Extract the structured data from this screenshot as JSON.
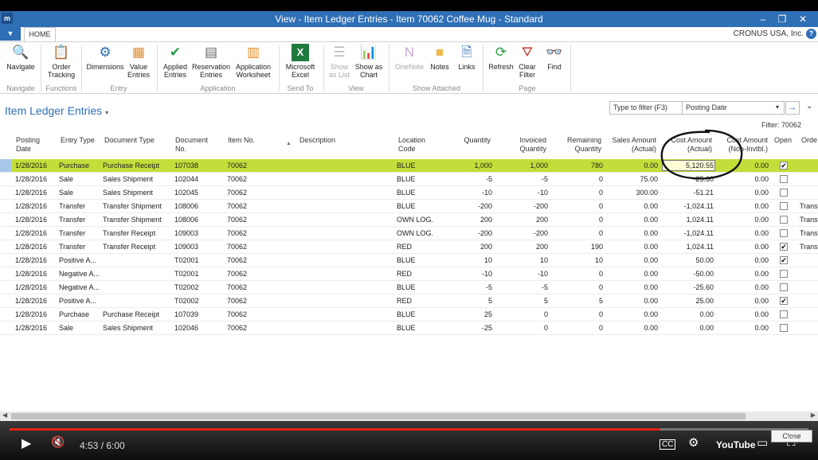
{
  "window": {
    "title": "View - Item Ledger Entries - Item 70062 Coffee Mug - Standard",
    "logo": "m",
    "min_icon": "minimize-icon",
    "restore_icon": "restore-icon",
    "close_icon": "close-icon"
  },
  "tabs": {
    "file_glyph": "▼",
    "home": "HOME",
    "company": "CRONUS USA, Inc.",
    "help": "?"
  },
  "ribbon": {
    "navigate": "Navigate",
    "order_tracking_1": "Order",
    "order_tracking_2": "Tracking",
    "dimensions": "Dimensions",
    "value_entries_1": "Value",
    "value_entries_2": "Entries",
    "applied_entries_1": "Applied",
    "applied_entries_2": "Entries",
    "reservation_entries_1": "Reservation",
    "reservation_entries_2": "Entries",
    "application_worksheet_1": "Application",
    "application_worksheet_2": "Worksheet",
    "microsoft_excel_1": "Microsoft",
    "microsoft_excel_2": "Excel",
    "show_as_list_1": "Show",
    "show_as_list_2": "as List",
    "show_as_chart_1": "Show as",
    "show_as_chart_2": "Chart",
    "onenote": "OneNote",
    "notes": "Notes",
    "links": "Links",
    "refresh": "Refresh",
    "clear_filter_1": "Clear",
    "clear_filter_2": "Filter",
    "find": "Find",
    "groups": {
      "navigate": "Navigate",
      "functions": "Functions",
      "entry": "Entry",
      "application": "Application",
      "send_to": "Send To",
      "view": "View",
      "show_attached": "Show Attached",
      "page": "Page"
    }
  },
  "page": {
    "title": "Item Ledger Entries",
    "caret": "▾",
    "filter_placeholder": "Type to filter (F3)",
    "filter_field": "Posting Date",
    "filter_dd": "▾",
    "filter_go": "→",
    "collapse": "⌄",
    "filter_line": "Filter: 70062"
  },
  "columns": {
    "posting_date_1": "Posting",
    "posting_date_2": "Date",
    "entry_type": "Entry Type",
    "document_type": "Document Type",
    "document_no_1": "Document",
    "document_no_2": "No.",
    "item_no": "Item No.",
    "sort_icon": "▲",
    "description": "Description",
    "location_code_1": "Location",
    "location_code_2": "Code",
    "quantity": "Quantity",
    "invoiced_quantity_1": "Invoiced",
    "invoiced_quantity_2": "Quantity",
    "remaining_quantity_1": "Remaining",
    "remaining_quantity_2": "Quantity",
    "sales_amount_1": "Sales Amount",
    "sales_amount_2": "(Actual)",
    "cost_amount_1": "Cost Amount",
    "cost_amount_2": "(Actual)",
    "cost_non_invtbl_1": "Cost Amount",
    "cost_non_invtbl_2": "(Non-Invtbl.)",
    "open": "Open",
    "order_type": "Orde"
  },
  "rows": [
    {
      "date": "1/28/2016",
      "entry_type": "Purchase",
      "doc_type": "Purchase Receipt",
      "doc_no": "107038",
      "item": "70062",
      "loc": "BLUE",
      "qty": "1,000",
      "inv": "1,000",
      "rem": "780",
      "sales": "0.00",
      "cost": "5,120.55",
      "nonint": "0.00",
      "open": true,
      "order": "",
      "selected": true
    },
    {
      "date": "1/28/2016",
      "entry_type": "Sale",
      "doc_type": "Sales Shipment",
      "doc_no": "102044",
      "item": "70062",
      "loc": "BLUE",
      "qty": "-5",
      "inv": "-5",
      "rem": "0",
      "sales": "75.00",
      "cost": "-25.60",
      "nonint": "0.00",
      "open": false,
      "order": ""
    },
    {
      "date": "1/28/2016",
      "entry_type": "Sale",
      "doc_type": "Sales Shipment",
      "doc_no": "102045",
      "item": "70062",
      "loc": "BLUE",
      "qty": "-10",
      "inv": "-10",
      "rem": "0",
      "sales": "300.00",
      "cost": "-51.21",
      "nonint": "0.00",
      "open": false,
      "order": ""
    },
    {
      "date": "1/28/2016",
      "entry_type": "Transfer",
      "doc_type": "Transfer Shipment",
      "doc_no": "108006",
      "item": "70062",
      "loc": "BLUE",
      "qty": "-200",
      "inv": "-200",
      "rem": "0",
      "sales": "0.00",
      "cost": "-1,024.11",
      "nonint": "0.00",
      "open": false,
      "order": "Transf"
    },
    {
      "date": "1/28/2016",
      "entry_type": "Transfer",
      "doc_type": "Transfer Shipment",
      "doc_no": "108006",
      "item": "70062",
      "loc": "OWN LOG.",
      "qty": "200",
      "inv": "200",
      "rem": "0",
      "sales": "0.00",
      "cost": "1,024.11",
      "nonint": "0.00",
      "open": false,
      "order": "Transf"
    },
    {
      "date": "1/28/2016",
      "entry_type": "Transfer",
      "doc_type": "Transfer Receipt",
      "doc_no": "109003",
      "item": "70062",
      "loc": "OWN LOG.",
      "qty": "-200",
      "inv": "-200",
      "rem": "0",
      "sales": "0.00",
      "cost": "-1,024.11",
      "nonint": "0.00",
      "open": false,
      "order": "Transf"
    },
    {
      "date": "1/28/2016",
      "entry_type": "Transfer",
      "doc_type": "Transfer Receipt",
      "doc_no": "109003",
      "item": "70062",
      "loc": "RED",
      "qty": "200",
      "inv": "200",
      "rem": "190",
      "sales": "0.00",
      "cost": "1,024.11",
      "nonint": "0.00",
      "open": true,
      "order": "Transf"
    },
    {
      "date": "1/28/2016",
      "entry_type": "Positive A...",
      "doc_type": "",
      "doc_no": "T02001",
      "item": "70062",
      "loc": "BLUE",
      "qty": "10",
      "inv": "10",
      "rem": "10",
      "sales": "0.00",
      "cost": "50.00",
      "nonint": "0.00",
      "open": true,
      "order": ""
    },
    {
      "date": "1/28/2016",
      "entry_type": "Negative A...",
      "doc_type": "",
      "doc_no": "T02001",
      "item": "70062",
      "loc": "RED",
      "qty": "-10",
      "inv": "-10",
      "rem": "0",
      "sales": "0.00",
      "cost": "-50.00",
      "nonint": "0.00",
      "open": false,
      "order": ""
    },
    {
      "date": "1/28/2016",
      "entry_type": "Negative A...",
      "doc_type": "",
      "doc_no": "T02002",
      "item": "70062",
      "loc": "BLUE",
      "qty": "-5",
      "inv": "-5",
      "rem": "0",
      "sales": "0.00",
      "cost": "-25.60",
      "nonint": "0.00",
      "open": false,
      "order": ""
    },
    {
      "date": "1/28/2016",
      "entry_type": "Positive A...",
      "doc_type": "",
      "doc_no": "T02002",
      "item": "70062",
      "loc": "RED",
      "qty": "5",
      "inv": "5",
      "rem": "5",
      "sales": "0.00",
      "cost": "25.00",
      "nonint": "0.00",
      "open": true,
      "order": ""
    },
    {
      "date": "1/28/2016",
      "entry_type": "Purchase",
      "doc_type": "Purchase Receipt",
      "doc_no": "107039",
      "item": "70062",
      "loc": "BLUE",
      "qty": "25",
      "inv": "0",
      "rem": "0",
      "sales": "0.00",
      "cost": "0.00",
      "nonint": "0.00",
      "open": false,
      "order": ""
    },
    {
      "date": "1/28/2016",
      "entry_type": "Sale",
      "doc_type": "Sales Shipment",
      "doc_no": "102046",
      "item": "70062",
      "loc": "BLUE",
      "qty": "-25",
      "inv": "0",
      "rem": "0",
      "sales": "0.00",
      "cost": "0.00",
      "nonint": "0.00",
      "open": false,
      "order": ""
    }
  ],
  "scroll": {
    "left": "◀",
    "right": "▶"
  },
  "player": {
    "time": "4:53 / 6:00",
    "progress": 0.815,
    "close": "Close",
    "youtube": "YouTube",
    "play_glyph": "▶",
    "vol_glyph": "🔇",
    "cc_glyph": "CC",
    "settings_glyph": "⚙",
    "cast_glyph": "▭",
    "full_glyph": "⛶",
    "accent": "#e62117"
  }
}
